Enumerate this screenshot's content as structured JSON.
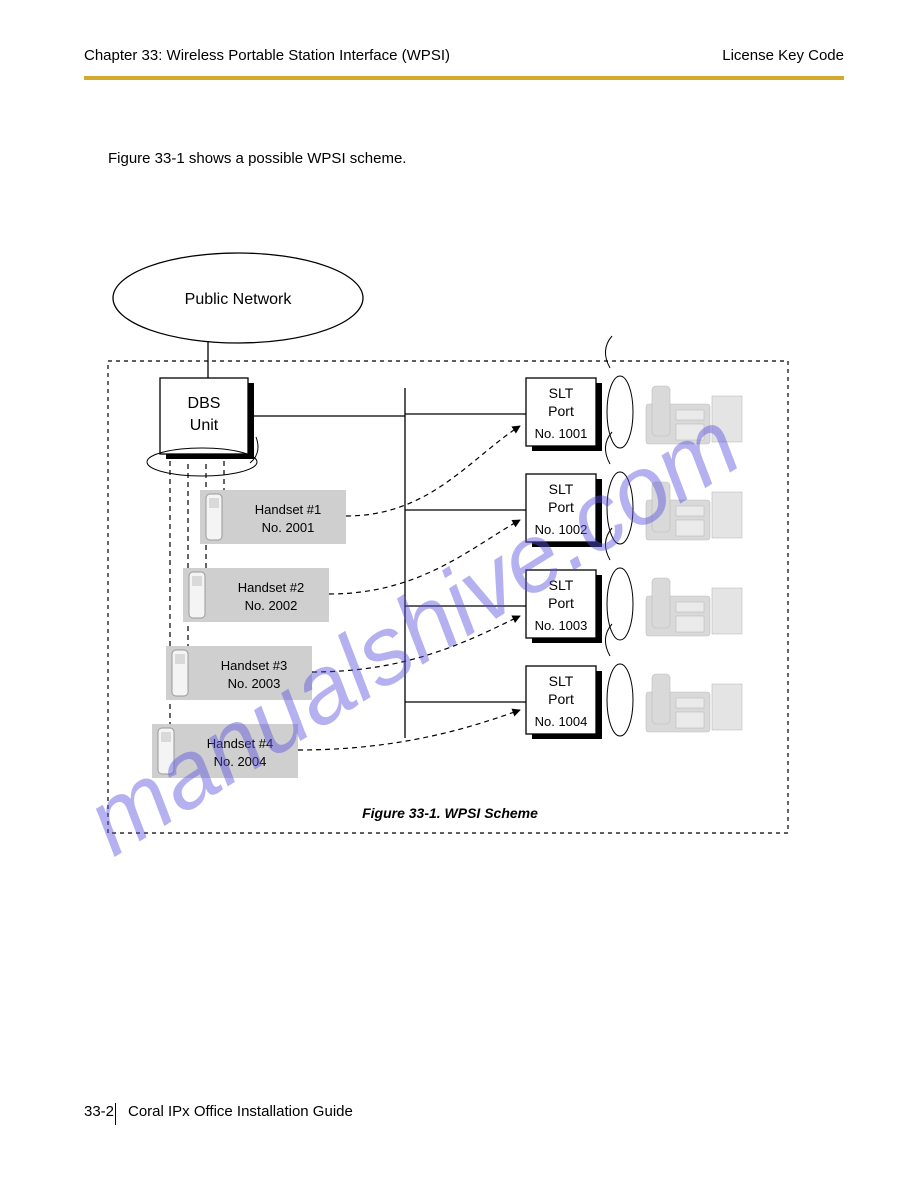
{
  "header": {
    "chapter": "Chapter 33: Wireless Portable Station Interface (WPSI)",
    "right": "License Key Code"
  },
  "paragraph": "Figure 33-1 shows a possible WPSI scheme.",
  "diagram": {
    "title": "Figure 33-1. WPSI Scheme",
    "cloud": "Public Network",
    "base_top": "DBS",
    "base_bottom": "Unit",
    "handsets": [
      {
        "label": "Handset #1",
        "num": "No. 2001"
      },
      {
        "label": "Handset #2",
        "num": "No. 2002"
      },
      {
        "label": "Handset #3",
        "num": "No. 2003"
      },
      {
        "label": "Handset #4",
        "num": "No. 2004"
      }
    ],
    "ports": [
      {
        "top": "SLT",
        "mid": "Port",
        "num": "No. 1001"
      },
      {
        "top": "SLT",
        "mid": "Port",
        "num": "No. 1002"
      },
      {
        "top": "SLT",
        "mid": "Port",
        "num": "No. 1003"
      },
      {
        "top": "SLT",
        "mid": "Port",
        "num": "No. 1004"
      }
    ]
  },
  "footer": {
    "page": "33-2",
    "title": "Coral IPx Office Installation Guide"
  }
}
